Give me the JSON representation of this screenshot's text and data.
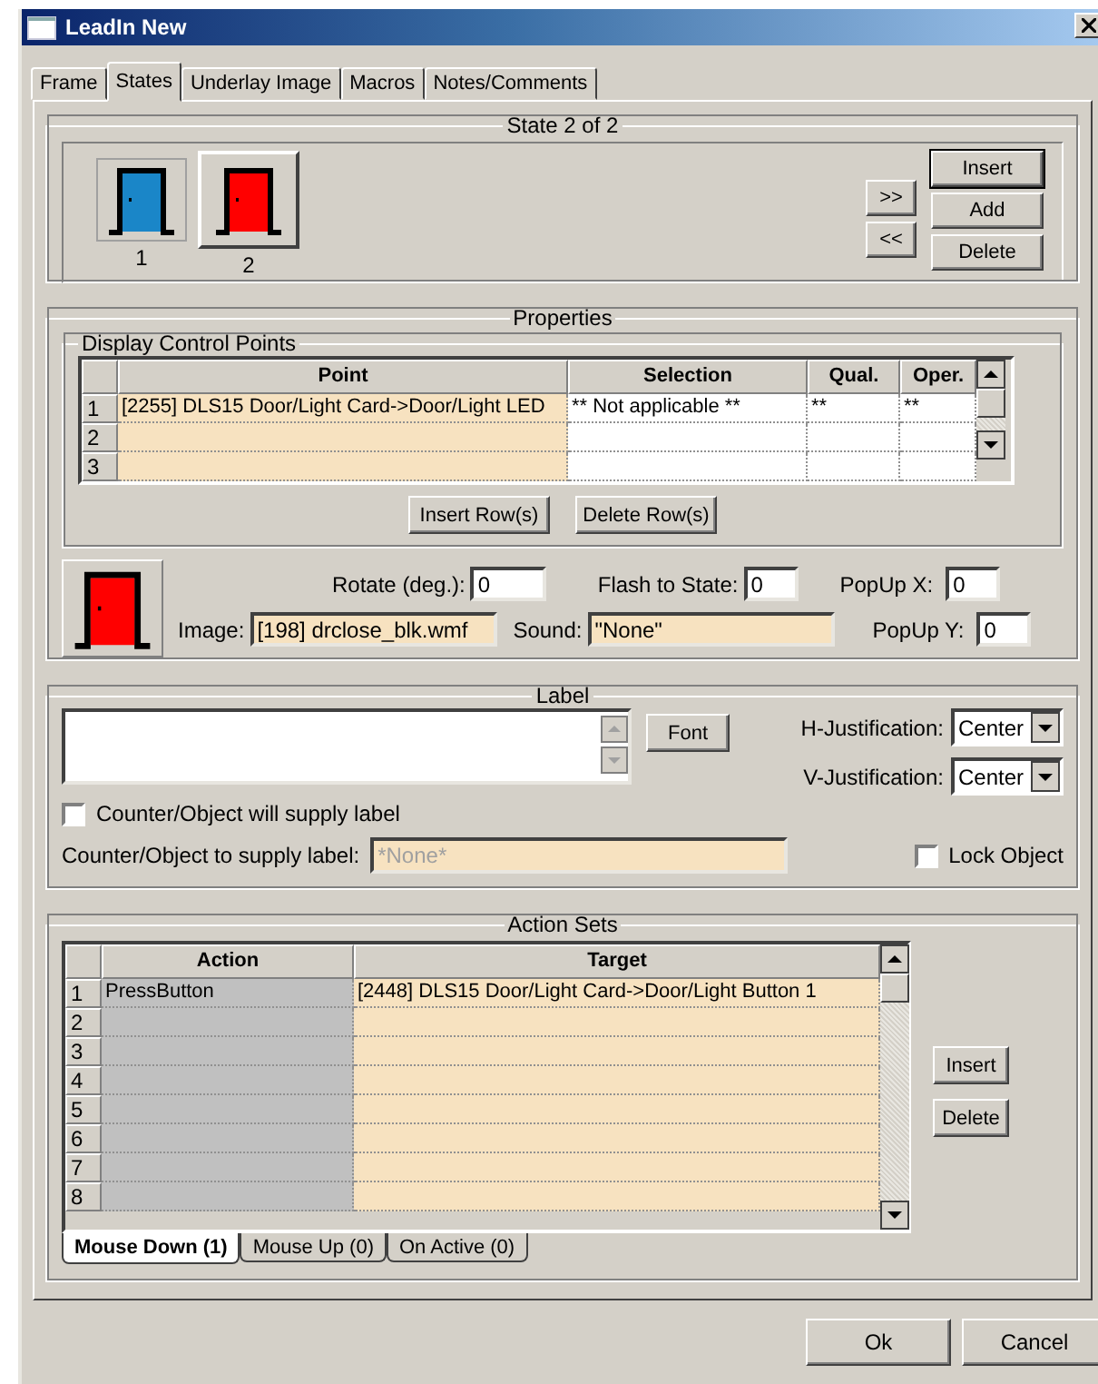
{
  "window": {
    "title": "LeadIn New"
  },
  "tabs": [
    {
      "label": "Frame",
      "selected": false
    },
    {
      "label": "States",
      "selected": true
    },
    {
      "label": "Underlay Image",
      "selected": false
    },
    {
      "label": "Macros",
      "selected": false
    },
    {
      "label": "Notes/Comments",
      "selected": false
    }
  ],
  "states": {
    "title": "State 2 of 2",
    "items": [
      {
        "label": "1",
        "color": "#1a86c8",
        "selected": false
      },
      {
        "label": "2",
        "color": "#ff0000",
        "selected": true
      }
    ],
    "nav_buttons": [
      ">>",
      "<<"
    ],
    "buttons": [
      {
        "label": "Insert",
        "default": true
      },
      {
        "label": "Add",
        "default": false
      },
      {
        "label": "Delete",
        "default": false
      }
    ]
  },
  "properties": {
    "title": "Properties",
    "control_points": {
      "title": "Display Control Points",
      "columns": [
        "Point",
        "Selection",
        "Qual.",
        "Oper."
      ],
      "rows": [
        {
          "number": "1",
          "cells": [
            "[2255] DLS15 Door/Light Card->Door/Light LED",
            "** Not applicable **",
            "**",
            "**"
          ]
        },
        {
          "number": "2"
        },
        {
          "number": "3"
        }
      ],
      "buttons": [
        "Insert Row(s)",
        "Delete Row(s)"
      ]
    },
    "rotate": {
      "label": "Rotate (deg.):",
      "value": "0"
    },
    "flash": {
      "label": "Flash to State:",
      "value": "0"
    },
    "popup_x": {
      "label": "PopUp X:",
      "value": "0"
    },
    "image": {
      "label": "Image:",
      "value": "[198] drclose_blk.wmf"
    },
    "sound": {
      "label": "Sound:",
      "value": "\"None\""
    },
    "popup_y": {
      "label": "PopUp Y:",
      "value": "0"
    }
  },
  "label": {
    "title": "Label",
    "font_button": "Font",
    "h_justification": {
      "label": "H-Justification:",
      "value": "Center"
    },
    "v_justification": {
      "label": "V-Justification:",
      "value": "Center"
    },
    "supply_checkbox": {
      "label": "Counter/Object will supply label",
      "checked": false
    },
    "supply_field": {
      "label": "Counter/Object to supply label:",
      "value": "*None*",
      "disabled": true
    },
    "lock_checkbox": {
      "label": "Lock Object",
      "checked": false
    }
  },
  "action_sets": {
    "title": "Action Sets",
    "columns": [
      "Action",
      "Target"
    ],
    "rows": [
      {
        "number": "1",
        "action": "PressButton",
        "target": "[2448] DLS15 Door/Light Card->Door/Light Button 1"
      },
      {
        "number": "2"
      },
      {
        "number": "3"
      },
      {
        "number": "4"
      },
      {
        "number": "5"
      },
      {
        "number": "6"
      },
      {
        "number": "7"
      },
      {
        "number": "8"
      }
    ],
    "buttons": [
      "Insert",
      "Delete"
    ],
    "tabs": [
      {
        "label": "Mouse Down (1)",
        "selected": true
      },
      {
        "label": "Mouse Up (0)",
        "selected": false
      },
      {
        "label": "On Active (0)",
        "selected": false
      }
    ]
  },
  "footer_buttons": [
    "Ok",
    "Cancel"
  ]
}
